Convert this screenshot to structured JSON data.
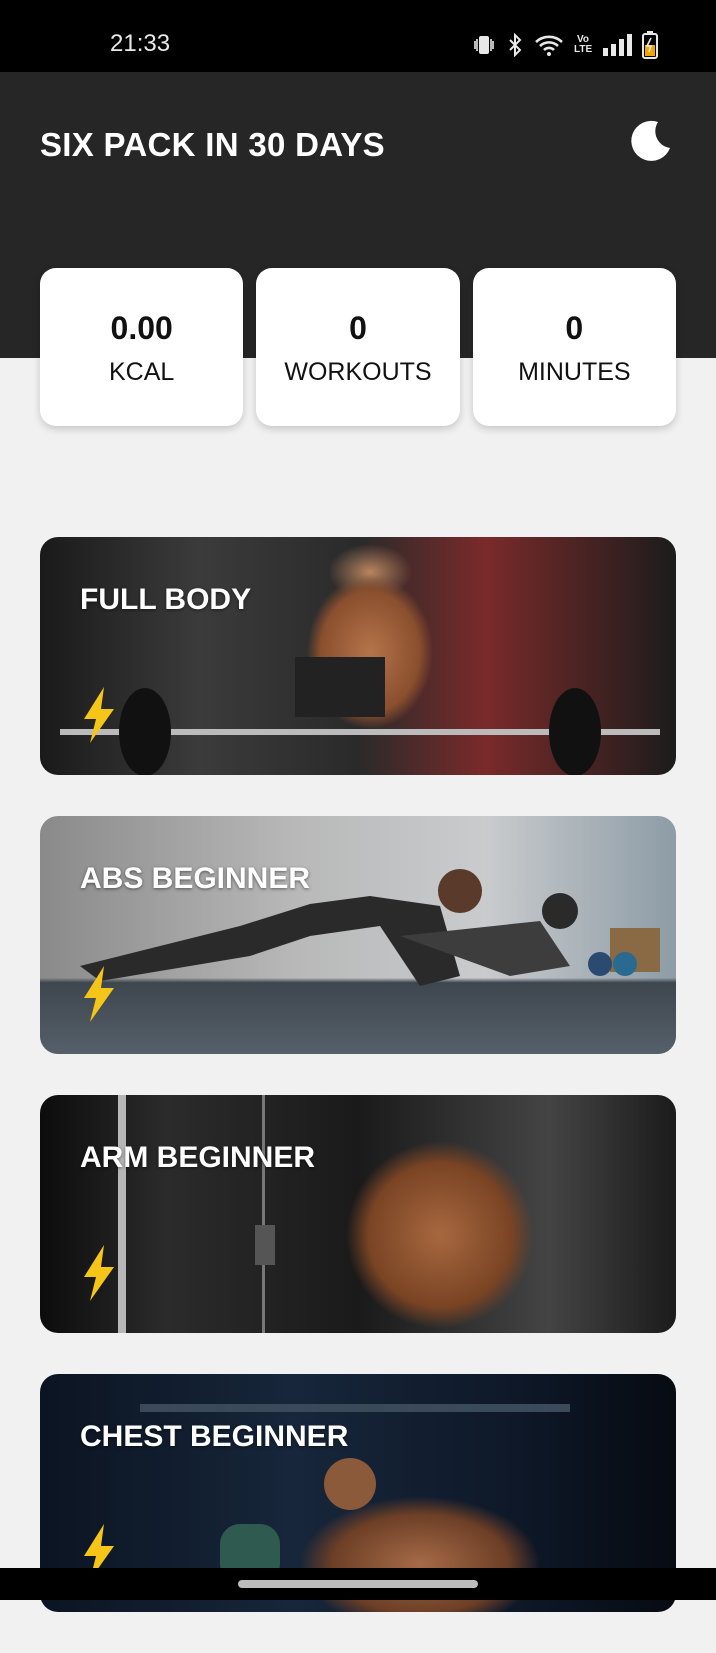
{
  "status_bar": {
    "time": "21:33",
    "icons": [
      "vibrate-icon",
      "bluetooth-icon",
      "wifi-icon",
      "volte-icon",
      "signal-icon",
      "battery-icon"
    ],
    "volte_text": "Vo LTE"
  },
  "header": {
    "title": "SIX PACK IN 30 DAYS",
    "theme_toggle_icon": "moon-icon",
    "background": "#262626"
  },
  "stats": [
    {
      "value": "0.00",
      "label": "KCAL"
    },
    {
      "value": "0",
      "label": "WORKOUTS"
    },
    {
      "value": "0",
      "label": "MINUTES"
    }
  ],
  "workouts": [
    {
      "title": "FULL BODY",
      "icon": "lightning-bolt-icon"
    },
    {
      "title": "ABS BEGINNER",
      "icon": "lightning-bolt-icon"
    },
    {
      "title": "ARM BEGINNER",
      "icon": "lightning-bolt-icon"
    },
    {
      "title": "CHEST BEGINNER",
      "icon": "lightning-bolt-icon"
    }
  ],
  "colors": {
    "accent_bolt": "#f5c518",
    "page_background": "#f1f1f1"
  }
}
